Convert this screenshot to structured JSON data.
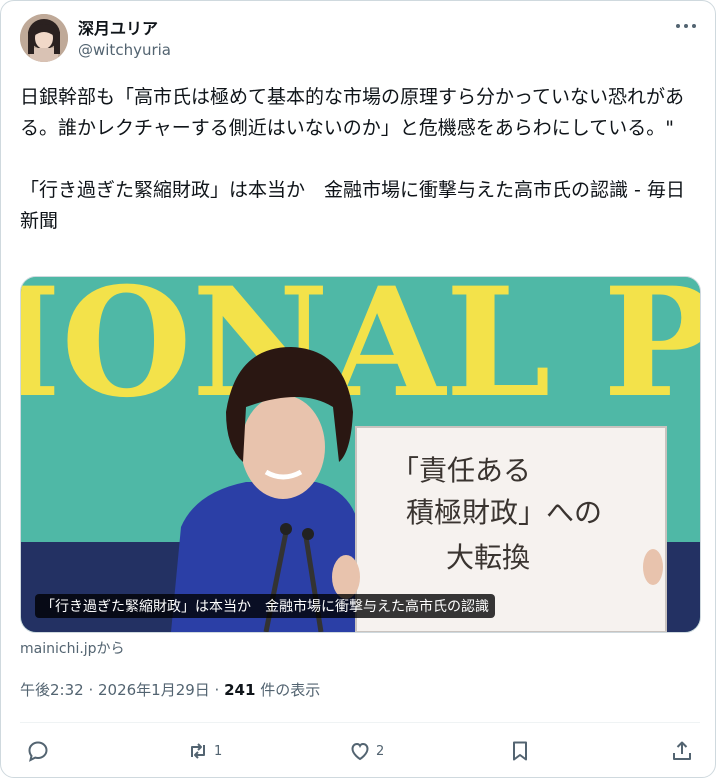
{
  "user": {
    "name": "深月ユリア",
    "handle": "@witchyuria"
  },
  "tweet": {
    "text": "日銀幹部も「高市氏は極めて基本的な市場の原理すら分かっていない恐れがある。誰かレクチャーする側近はいないのか」と危機感をあらわにしている。\"\n\n「行き過ぎた緊縮財政」は本当か　金融市場に衝撃与えた高市氏の認識 - 毎日新聞"
  },
  "card": {
    "backdrop_text": "IONAL P",
    "board_lines": [
      "「責任ある",
      "積極財政」への",
      "大転換"
    ],
    "caption": "「行き過ぎた緊縮財政」は本当か　金融市場に衝撃与えた高市氏の認識",
    "source": "mainichi.jpから"
  },
  "meta": {
    "time": "午後2:32 · 2026年1月29日 · ",
    "views_count": "241",
    "views_label": " 件の表示"
  },
  "actions": {
    "reply_count": "",
    "retweet_count": "1",
    "like_count": "2"
  },
  "colors": {
    "backdrop_teal": "#4fb8a6",
    "backdrop_yellow": "#f3e24a",
    "jacket_blue": "#2b3fa6",
    "text_secondary": "#536471"
  }
}
